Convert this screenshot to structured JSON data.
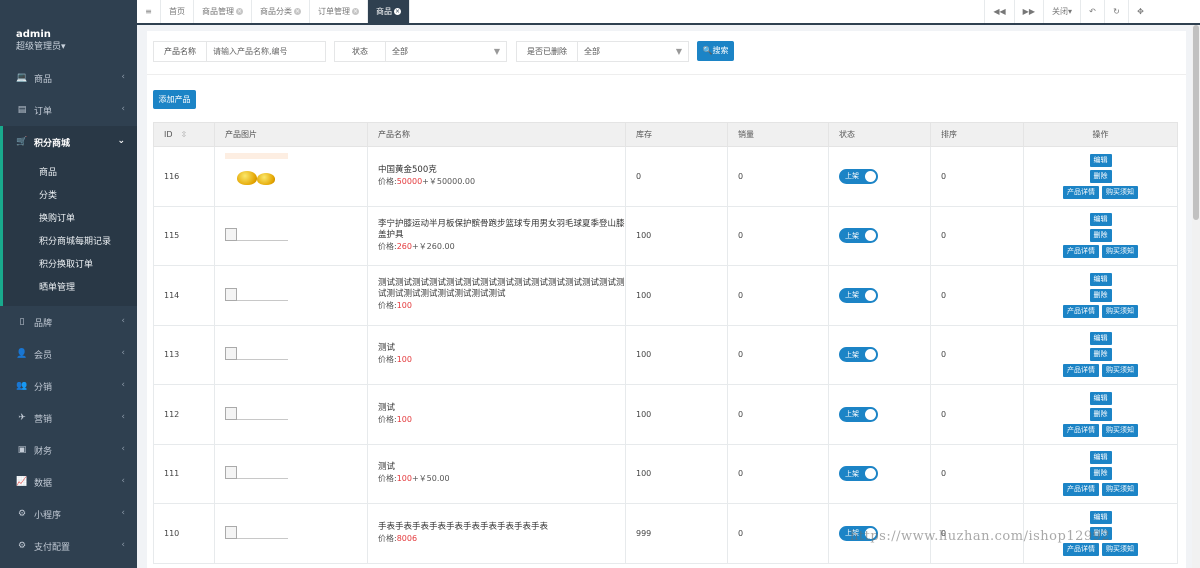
{
  "user": {
    "name": "admin",
    "role": "超级管理员▾"
  },
  "sidebar": {
    "items_top": [
      {
        "label": "商品",
        "icon": "💻"
      },
      {
        "label": "订单",
        "icon": "▤"
      }
    ],
    "active": {
      "label": "积分商城",
      "icon": "🛒"
    },
    "sub_items": [
      "商品",
      "分类",
      "换购订单",
      "积分商城每期记录",
      "积分换取订单",
      "晒单管理"
    ],
    "items_bottom": [
      {
        "label": "品牌",
        "icon": "▯"
      },
      {
        "label": "会员",
        "icon": "👤"
      },
      {
        "label": "分销",
        "icon": "👥"
      },
      {
        "label": "营销",
        "icon": "✈"
      },
      {
        "label": "财务",
        "icon": "▣"
      },
      {
        "label": "数据",
        "icon": "📈"
      },
      {
        "label": "小程序",
        "icon": "⚙"
      },
      {
        "label": "支付配置",
        "icon": "⚙"
      }
    ]
  },
  "topbar": {
    "menu_icon": "≡",
    "tabs": [
      {
        "label": "首页",
        "closable": false,
        "active": false
      },
      {
        "label": "商品管理",
        "closable": true,
        "active": false
      },
      {
        "label": "商品分类",
        "closable": true,
        "active": false
      },
      {
        "label": "订单管理",
        "closable": true,
        "active": false
      },
      {
        "label": "商品",
        "closable": true,
        "active": true
      }
    ],
    "prev": "◀◀",
    "next": "▶▶",
    "close_label": "关闭▾",
    "back": "↶",
    "refresh": "↻",
    "fullscreen": "✥"
  },
  "filters": {
    "name_label": "产品名称",
    "name_placeholder": "请输入产品名称,编号",
    "status_label": "状态",
    "status_value": "全部",
    "deleted_label": "是否已删除",
    "deleted_value": "全部",
    "search_button": "🔍搜索"
  },
  "add_button": "添加产品",
  "table": {
    "headers": [
      "ID",
      "产品图片",
      "产品名称",
      "库存",
      "销量",
      "状态",
      "排序",
      "操作"
    ],
    "rows": [
      {
        "id": "116",
        "image": "gold",
        "name": "中国黄金500克",
        "points": "50000",
        "cash": "+￥50000.00",
        "stock": "0",
        "sales": "0",
        "status": "上架",
        "sort": "0"
      },
      {
        "id": "115",
        "image": "broken",
        "name": "李宁护膝运动半月板保护髌骨跑步篮球专用男女羽毛球夏季登山膝盖护具",
        "points": "260",
        "cash": "+￥260.00",
        "stock": "100",
        "sales": "0",
        "status": "上架",
        "sort": "0"
      },
      {
        "id": "114",
        "image": "broken",
        "name": "测试测试测试测试测试测试测试测试测试测试测试测试测试测试测试测试测试测试测试测试测试测试",
        "points": "100",
        "cash": "",
        "stock": "100",
        "sales": "0",
        "status": "上架",
        "sort": "0"
      },
      {
        "id": "113",
        "image": "broken",
        "name": "测试",
        "points": "100",
        "cash": "",
        "stock": "100",
        "sales": "0",
        "status": "上架",
        "sort": "0"
      },
      {
        "id": "112",
        "image": "broken",
        "name": "测试",
        "points": "100",
        "cash": "",
        "stock": "100",
        "sales": "0",
        "status": "上架",
        "sort": "0"
      },
      {
        "id": "111",
        "image": "broken",
        "name": "测试",
        "points": "100",
        "cash": "+￥50.00",
        "stock": "100",
        "sales": "0",
        "status": "上架",
        "sort": "0"
      },
      {
        "id": "110",
        "image": "broken",
        "name": "手表手表手表手表手表手表手表手表手表手表",
        "points": "8006",
        "cash": "",
        "stock": "999",
        "sales": "0",
        "status": "上架",
        "sort": "0"
      }
    ],
    "price_prefix": "价格:",
    "ops": {
      "edit": "编辑",
      "delete": "删除",
      "detail": "产品详情",
      "notice": "购买须知"
    }
  },
  "watermark": "https://www.huzhan.com/ishop12992"
}
